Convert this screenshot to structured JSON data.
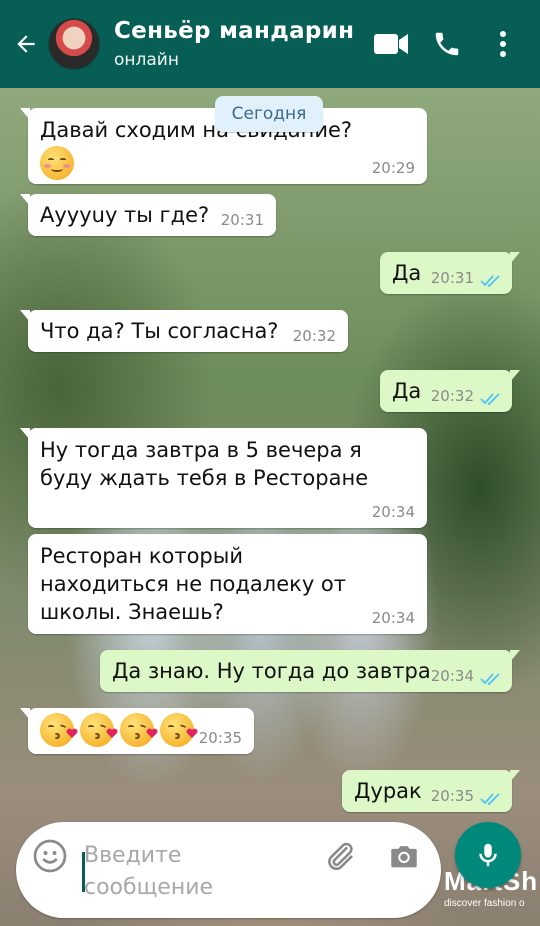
{
  "header": {
    "contact_name": "Сеньёр мандарин",
    "status": "онлайн",
    "background_color": "#075e54",
    "icons": [
      "back-arrow-icon",
      "video-call-icon",
      "phone-icon",
      "more-options-icon"
    ]
  },
  "chat": {
    "date_chip": "Сегодня",
    "messages": [
      {
        "direction": "in",
        "text": "Давай сходим на свидание?",
        "emoji": "smiling-face-emoji",
        "time": "20:29"
      },
      {
        "direction": "in",
        "text": "Ауууuу ты где?",
        "time": "20:31"
      },
      {
        "direction": "out",
        "text": "Да",
        "time": "20:31",
        "status": "read"
      },
      {
        "direction": "in",
        "text": "Что да? Ты согласна?",
        "time": "20:32"
      },
      {
        "direction": "out",
        "text": "Да",
        "time": "20:32",
        "status": "read"
      },
      {
        "direction": "in",
        "text": "Ну тогда завтра в 5 вечера я буду ждать тебя в Ресторане",
        "time": "20:34"
      },
      {
        "direction": "in",
        "text": "Ресторан который находиться не подалеку от школы. Знаешь?",
        "time": "20:34"
      },
      {
        "direction": "out",
        "text": "Да знаю. Ну тогда до завтра",
        "time": "20:34",
        "status": "read"
      },
      {
        "direction": "in",
        "text": "",
        "emoji": "face-blowing-kiss-emoji x4",
        "time": "20:35"
      },
      {
        "direction": "out",
        "text": "Дурак",
        "time": "20:35",
        "status": "read"
      }
    ],
    "incoming_bubble_color": "#ffffff",
    "outgoing_bubble_color": "#dcf8c6",
    "read_tick_color": "#4fc3f7"
  },
  "composer": {
    "placeholder": "Введите сообщение",
    "icons": [
      "emoji-icon",
      "attach-icon",
      "camera-icon",
      "mic-icon"
    ],
    "mic_button_color": "#00897b"
  },
  "wallpaper": {
    "watermark": "MartSh",
    "watermark_sub": "discover fashion o"
  }
}
